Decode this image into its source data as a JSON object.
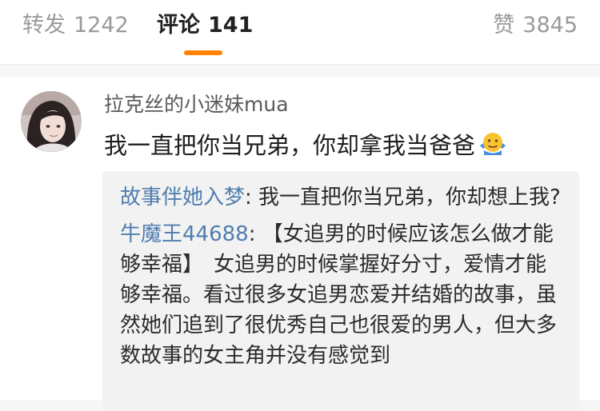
{
  "tabs": {
    "forward": {
      "label": "转发",
      "count": "1242"
    },
    "comments": {
      "label": "评论",
      "count": "141"
    },
    "likes": {
      "label": "赞",
      "count": "3845"
    }
  },
  "comment": {
    "username": "拉克丝的小迷妹mua",
    "text": "我一直把你当兄弟，你却拿我当爸爸",
    "emoji": "shrug-emoji"
  },
  "replies": [
    {
      "author": "故事伴她入梦",
      "separator": ": ",
      "text": "我一直把你当兄弟，你却想上我?"
    },
    {
      "author": "牛魔王44688",
      "separator": ": ",
      "text": "【女追男的时候应该怎么做才能够幸福】　女追男的时候掌握好分寸，爱情才能够幸福。看过很多女追男恋爱并结婚的故事，虽然她们追到了很优秀自己也很爱的男人，但大多数故事的女主角并没有感觉到"
    }
  ],
  "colors": {
    "accent": "#ff8200",
    "link": "#507daf"
  }
}
